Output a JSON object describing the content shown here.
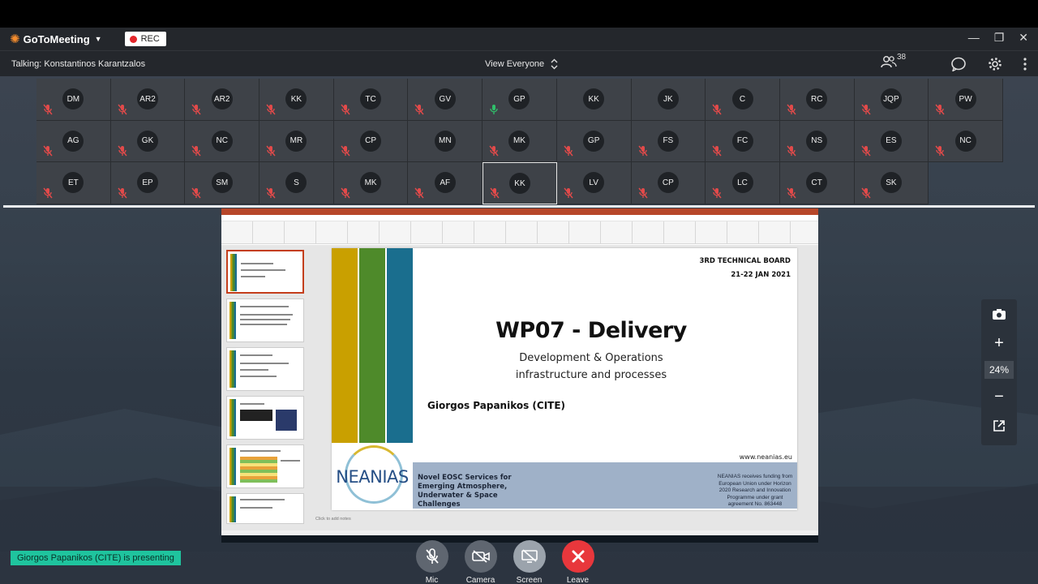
{
  "app": {
    "name": "GoToMeeting",
    "rec_label": "REC"
  },
  "header": {
    "talking": "Talking: Konstantinos Karantzalos",
    "view_selector": "View Everyone",
    "attendee_count": "38"
  },
  "participants": [
    {
      "initials": "DM",
      "mic": "muted"
    },
    {
      "initials": "AR2",
      "mic": "muted"
    },
    {
      "initials": "AR2",
      "mic": "muted"
    },
    {
      "initials": "KK",
      "mic": "muted"
    },
    {
      "initials": "TC",
      "mic": "muted"
    },
    {
      "initials": "GV",
      "mic": "muted"
    },
    {
      "initials": "GP",
      "mic": "on"
    },
    {
      "initials": "KK",
      "mic": "none"
    },
    {
      "initials": "JK",
      "mic": "none"
    },
    {
      "initials": "C",
      "mic": "muted"
    },
    {
      "initials": "RC",
      "mic": "muted"
    },
    {
      "initials": "JQP",
      "mic": "muted"
    },
    {
      "initials": "PW",
      "mic": "muted"
    },
    {
      "initials": "AG",
      "mic": "muted"
    },
    {
      "initials": "GK",
      "mic": "muted"
    },
    {
      "initials": "NC",
      "mic": "muted"
    },
    {
      "initials": "MR",
      "mic": "muted"
    },
    {
      "initials": "CP",
      "mic": "muted"
    },
    {
      "initials": "MN",
      "mic": "none"
    },
    {
      "initials": "MK",
      "mic": "muted"
    },
    {
      "initials": "GP",
      "mic": "muted"
    },
    {
      "initials": "FS",
      "mic": "muted"
    },
    {
      "initials": "FC",
      "mic": "muted"
    },
    {
      "initials": "NS",
      "mic": "muted"
    },
    {
      "initials": "ES",
      "mic": "muted"
    },
    {
      "initials": "NC",
      "mic": "muted"
    },
    {
      "initials": "ET",
      "mic": "muted"
    },
    {
      "initials": "EP",
      "mic": "muted"
    },
    {
      "initials": "SM",
      "mic": "muted"
    },
    {
      "initials": "S",
      "mic": "muted"
    },
    {
      "initials": "MK",
      "mic": "muted"
    },
    {
      "initials": "AF",
      "mic": "muted"
    },
    {
      "initials": "KK",
      "mic": "muted",
      "active": true
    },
    {
      "initials": "LV",
      "mic": "muted"
    },
    {
      "initials": "CP",
      "mic": "muted"
    },
    {
      "initials": "LC",
      "mic": "muted"
    },
    {
      "initials": "CT",
      "mic": "muted"
    },
    {
      "initials": "SK",
      "mic": "muted"
    }
  ],
  "slide": {
    "board_line1": "3RD TECHNICAL BOARD",
    "board_line2": "21-22 JAN 2021",
    "title": "WP07 - Delivery",
    "subtitle_line1": "Development & Operations",
    "subtitle_line2": "infrastructure and processes",
    "author": "Giorgos Papanikos (CITE)",
    "url": "www.neanias.eu",
    "logo_text": "NEANIAS",
    "band_text": "Novel EOSC Services for Emerging Atmosphere, Underwater & Space Challenges",
    "funding_text": "NEANIAS receives funding from European Union under Horizon 2020 Research and Innovation Programme under grant agreement No. 863448",
    "bar_colors": [
      "#c9a000",
      "#4e8a2a",
      "#1a6e8e"
    ],
    "notes_placeholder": "Click to add notes"
  },
  "zoom": {
    "percent": "24%"
  },
  "presenting_banner": "Giorgos Papanikos (CITE) is presenting",
  "controls": {
    "mic": "Mic",
    "camera": "Camera",
    "screen": "Screen",
    "leave": "Leave"
  },
  "colors": {
    "accent": "#1fc49e",
    "leave": "#e8373c",
    "brand": "#f68d2e",
    "muted": "#e24a4a",
    "mic_on": "#2fc06a"
  }
}
